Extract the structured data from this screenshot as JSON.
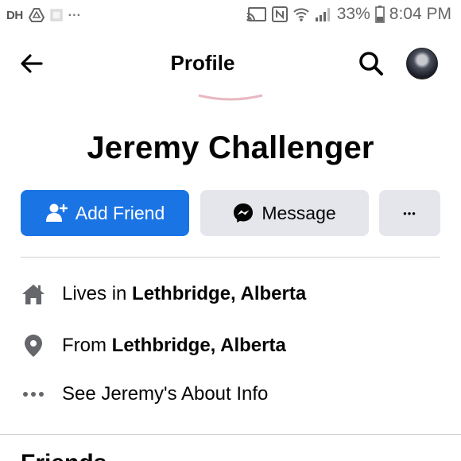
{
  "status_bar": {
    "carrier_label": "DH",
    "more_dots": "...",
    "battery_percent": "33%",
    "time": "8:04 PM",
    "icons": [
      "drive-icon",
      "image-icon",
      "cast-icon",
      "nfc-icon",
      "wifi-icon",
      "signal-icon",
      "battery-icon"
    ]
  },
  "header": {
    "title": "Profile",
    "back_icon": "arrow-left-icon",
    "search_icon": "search-icon"
  },
  "profile": {
    "name": "Jeremy Challenger"
  },
  "actions": {
    "add_friend_label": "Add Friend",
    "message_label": "Message",
    "more_label": "•••"
  },
  "info": {
    "lives_prefix": "Lives in ",
    "lives_place": "Lethbridge, Alberta",
    "from_prefix": "From ",
    "from_place": "Lethbridge, Alberta",
    "about_text": "See Jeremy's About Info"
  },
  "sections": {
    "friends_heading": "Friends"
  },
  "colors": {
    "primary_button": "#1b74e4",
    "secondary_button": "#e4e6eb",
    "divider": "#ced0d4",
    "icon_gray": "#65676b"
  }
}
